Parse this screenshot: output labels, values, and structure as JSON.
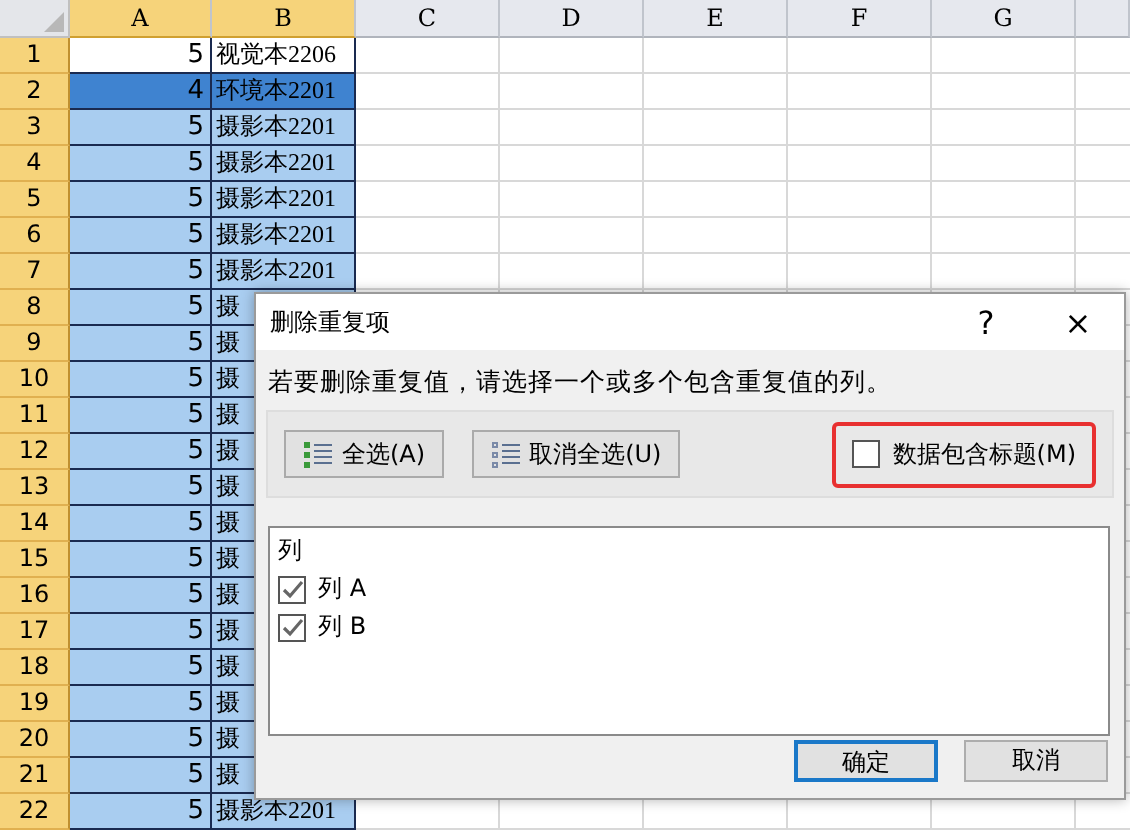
{
  "sheet": {
    "columns": [
      {
        "label": "A",
        "selected": true
      },
      {
        "label": "B",
        "selected": true
      },
      {
        "label": "C",
        "selected": false
      },
      {
        "label": "D",
        "selected": false
      },
      {
        "label": "E",
        "selected": false
      },
      {
        "label": "F",
        "selected": false
      },
      {
        "label": "G",
        "selected": false
      }
    ],
    "rows": [
      {
        "number": "1",
        "kind": "active",
        "cells": [
          "5",
          "视觉本2206"
        ]
      },
      {
        "number": "2",
        "kind": "current",
        "cells": [
          "4",
          "环境本2201"
        ]
      },
      {
        "number": "3",
        "kind": "selected",
        "cells": [
          "5",
          "摄影本2201"
        ]
      },
      {
        "number": "4",
        "kind": "selected",
        "cells": [
          "5",
          "摄影本2201"
        ]
      },
      {
        "number": "5",
        "kind": "selected",
        "cells": [
          "5",
          "摄影本2201"
        ]
      },
      {
        "number": "6",
        "kind": "selected",
        "cells": [
          "5",
          "摄影本2201"
        ]
      },
      {
        "number": "7",
        "kind": "selected",
        "cells": [
          "5",
          "摄影本2201"
        ]
      },
      {
        "number": "8",
        "kind": "selected",
        "cells": [
          "5",
          "摄"
        ]
      },
      {
        "number": "9",
        "kind": "selected",
        "cells": [
          "5",
          "摄"
        ]
      },
      {
        "number": "10",
        "kind": "selected",
        "cells": [
          "5",
          "摄"
        ]
      },
      {
        "number": "11",
        "kind": "selected",
        "cells": [
          "5",
          "摄"
        ]
      },
      {
        "number": "12",
        "kind": "selected",
        "cells": [
          "5",
          "摄"
        ]
      },
      {
        "number": "13",
        "kind": "selected",
        "cells": [
          "5",
          "摄"
        ]
      },
      {
        "number": "14",
        "kind": "selected",
        "cells": [
          "5",
          "摄"
        ]
      },
      {
        "number": "15",
        "kind": "selected",
        "cells": [
          "5",
          "摄"
        ]
      },
      {
        "number": "16",
        "kind": "selected",
        "cells": [
          "5",
          "摄"
        ]
      },
      {
        "number": "17",
        "kind": "selected",
        "cells": [
          "5",
          "摄"
        ]
      },
      {
        "number": "18",
        "kind": "selected",
        "cells": [
          "5",
          "摄"
        ]
      },
      {
        "number": "19",
        "kind": "selected",
        "cells": [
          "5",
          "摄"
        ]
      },
      {
        "number": "20",
        "kind": "selected",
        "cells": [
          "5",
          "摄"
        ]
      },
      {
        "number": "21",
        "kind": "selected",
        "cells": [
          "5",
          "摄"
        ]
      },
      {
        "number": "22",
        "kind": "selected",
        "cells": [
          "5",
          "摄影本2201"
        ]
      }
    ]
  },
  "dialog": {
    "title": "删除重复项",
    "help": "?",
    "close": "×",
    "instruction": "若要删除重复值，请选择一个或多个包含重复值的列。",
    "select_all": "全选(A)",
    "unselect_all": "取消全选(U)",
    "header_option": {
      "label": "数据包含标题(M)",
      "checked": false,
      "highlighted": true
    },
    "list_header": "列",
    "columns": [
      {
        "label": "列 A",
        "checked": true
      },
      {
        "label": "列 B",
        "checked": true
      }
    ],
    "ok": "确定",
    "cancel": "取消"
  }
}
